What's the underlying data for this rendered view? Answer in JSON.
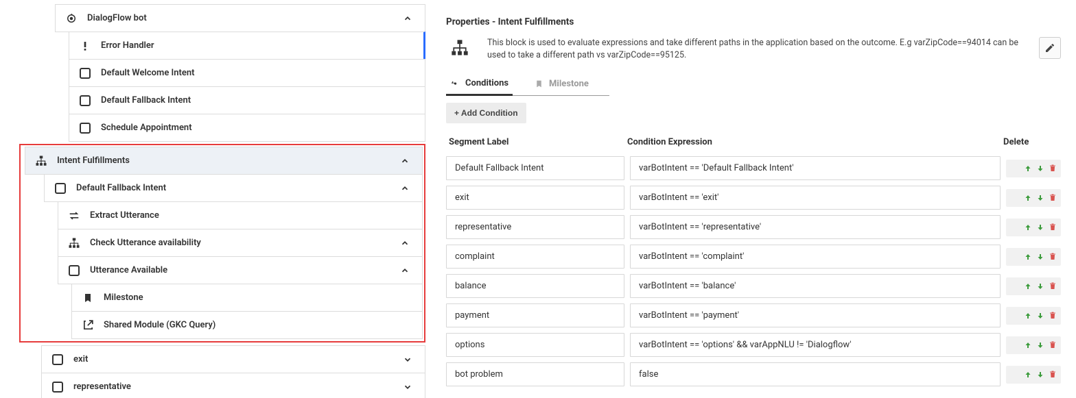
{
  "tree": {
    "root_label": "DialogFlow bot",
    "items": [
      {
        "id": "error",
        "label": "Error Handler",
        "icon": "exclaim-icon",
        "indent": "indent-1",
        "chevron": "",
        "row_class": "row-error"
      },
      {
        "id": "welcome",
        "label": "Default Welcome Intent",
        "icon": "checkbox-icon",
        "indent": "indent-1",
        "chevron": "",
        "row_class": ""
      },
      {
        "id": "fallback1",
        "label": "Default Fallback Intent",
        "icon": "checkbox-icon",
        "indent": "indent-1",
        "chevron": "",
        "row_class": ""
      },
      {
        "id": "schedule",
        "label": "Schedule Appointment",
        "icon": "checkbox-icon",
        "indent": "indent-1",
        "chevron": "",
        "row_class": ""
      }
    ],
    "highlighted": {
      "section_label": "Intent Fulfillments",
      "items": [
        {
          "id": "fallback2",
          "label": "Default Fallback Intent",
          "icon": "checkbox-icon",
          "indent": "indent-2",
          "chevron": "down"
        },
        {
          "id": "extract",
          "label": "Extract Utterance",
          "icon": "swap-icon",
          "indent": "indent-3",
          "chevron": ""
        },
        {
          "id": "checkutt",
          "label": "Check Utterance availability",
          "icon": "sitemap-icon",
          "indent": "indent-3",
          "chevron": "down"
        },
        {
          "id": "uttavail",
          "label": "Utterance Available",
          "icon": "checkbox-icon",
          "indent": "indent-4",
          "chevron": "down"
        },
        {
          "id": "milestone",
          "label": "Milestone",
          "icon": "bookmark-icon",
          "indent": "indent-5",
          "chevron": ""
        },
        {
          "id": "shared",
          "label": "Shared Module (GKC Query)",
          "icon": "external-icon",
          "indent": "indent-5",
          "chevron": ""
        }
      ]
    },
    "after": [
      {
        "id": "exit",
        "label": "exit",
        "icon": "checkbox-icon",
        "indent": "indent-2",
        "chevron": "right"
      },
      {
        "id": "rep",
        "label": "representative",
        "icon": "checkbox-icon",
        "indent": "indent-2",
        "chevron": "right"
      }
    ]
  },
  "properties": {
    "title": "Properties - Intent Fulfillments",
    "description": "This block is used to evaluate expressions and take different paths in the application based on the outcome. E.g varZipCode==94014 can be used to take a different path vs varZipCode==95125.",
    "tabs": {
      "conditions": "Conditions",
      "milestone": "Milestone"
    },
    "add_condition_label": "+  Add Condition",
    "columns": {
      "segment": "Segment Label",
      "expr": "Condition Expression",
      "delete": "Delete"
    },
    "rows": [
      {
        "segment": "Default Fallback Intent",
        "expr": "varBotIntent == 'Default Fallback Intent'"
      },
      {
        "segment": "exit",
        "expr": "varBotIntent == 'exit'"
      },
      {
        "segment": "representative",
        "expr": "varBotIntent == 'representative'"
      },
      {
        "segment": "complaint",
        "expr": "varBotIntent == 'complaint'"
      },
      {
        "segment": "balance",
        "expr": "varBotIntent == 'balance'"
      },
      {
        "segment": "payment",
        "expr": "varBotIntent == 'payment'"
      },
      {
        "segment": "options",
        "expr": "varBotIntent == 'options' && varAppNLU != 'Dialogflow'"
      },
      {
        "segment": "bot problem",
        "expr": "false"
      }
    ]
  }
}
